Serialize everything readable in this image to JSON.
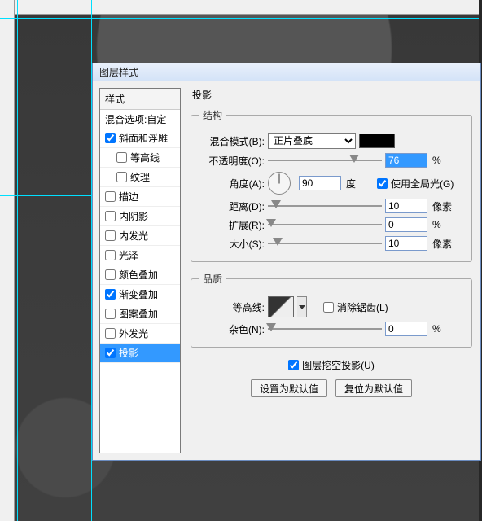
{
  "dialog": {
    "title": "图层样式"
  },
  "style_list": {
    "header": "样式",
    "blend_options": "混合选项:自定",
    "items": [
      {
        "key": "bevel",
        "label": "斜面和浮雕",
        "checked": true,
        "indent": false
      },
      {
        "key": "contour",
        "label": "等高线",
        "checked": false,
        "indent": true
      },
      {
        "key": "texture",
        "label": "纹理",
        "checked": false,
        "indent": true
      },
      {
        "key": "stroke",
        "label": "描边",
        "checked": false,
        "indent": false
      },
      {
        "key": "innershadow",
        "label": "内阴影",
        "checked": false,
        "indent": false
      },
      {
        "key": "innerglow",
        "label": "内发光",
        "checked": false,
        "indent": false
      },
      {
        "key": "satin",
        "label": "光泽",
        "checked": false,
        "indent": false
      },
      {
        "key": "coloroverlay",
        "label": "颜色叠加",
        "checked": false,
        "indent": false
      },
      {
        "key": "gradoverlay",
        "label": "渐变叠加",
        "checked": true,
        "indent": false
      },
      {
        "key": "patoverlay",
        "label": "图案叠加",
        "checked": false,
        "indent": false
      },
      {
        "key": "outerglow",
        "label": "外发光",
        "checked": false,
        "indent": false
      },
      {
        "key": "dropshadow",
        "label": "投影",
        "checked": true,
        "indent": false,
        "selected": true
      }
    ]
  },
  "panel": {
    "title": "投影",
    "structure": {
      "legend": "结构",
      "blend_mode_label": "混合模式(B):",
      "blend_mode_value": "正片叠底",
      "color": "#000000",
      "opacity_label": "不透明度(O):",
      "opacity_value": "76",
      "opacity_unit": "%",
      "angle_label": "角度(A):",
      "angle_value": "90",
      "angle_unit": "度",
      "global_light_label": "使用全局光(G)",
      "global_light_checked": true,
      "distance_label": "距离(D):",
      "distance_value": "10",
      "distance_unit": "像素",
      "spread_label": "扩展(R):",
      "spread_value": "0",
      "spread_unit": "%",
      "size_label": "大小(S):",
      "size_value": "10",
      "size_unit": "像素"
    },
    "quality": {
      "legend": "品质",
      "contour_label": "等高线:",
      "antialias_label": "消除锯齿(L)",
      "antialias_checked": false,
      "noise_label": "杂色(N):",
      "noise_value": "0",
      "noise_unit": "%"
    },
    "knockout_label": "图层挖空投影(U)",
    "knockout_checked": true,
    "btn_default": "设置为默认值",
    "btn_reset": "复位为默认值"
  }
}
